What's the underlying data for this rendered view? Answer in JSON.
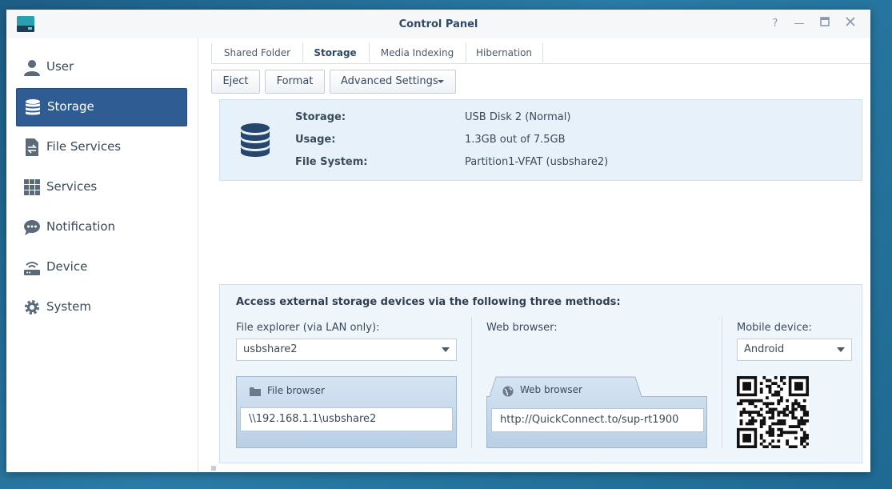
{
  "window": {
    "title": "Control Panel"
  },
  "sidebar": {
    "items": [
      {
        "label": "User",
        "icon": "user-icon"
      },
      {
        "label": "Storage",
        "icon": "storage-icon",
        "active": true
      },
      {
        "label": "File Services",
        "icon": "file-services-icon"
      },
      {
        "label": "Services",
        "icon": "services-grid-icon"
      },
      {
        "label": "Notification",
        "icon": "notification-icon"
      },
      {
        "label": "Device",
        "icon": "device-icon"
      },
      {
        "label": "System",
        "icon": "gear-icon"
      }
    ]
  },
  "tabs": [
    "Shared Folder",
    "Storage",
    "Media Indexing",
    "Hibernation"
  ],
  "toolbar": {
    "eject": "Eject",
    "format": "Format",
    "advanced": "Advanced Settings"
  },
  "info": {
    "storage_label": "Storage:",
    "storage_value": "USB Disk 2 (Normal)",
    "usage_label": "Usage:",
    "usage_value": "1.3GB out of 7.5GB",
    "fs_label": "File System:",
    "fs_value": "Partition1-VFAT (usbshare2)"
  },
  "access": {
    "title": "Access external storage devices via the following three methods:",
    "file_explorer_label": "File explorer (via LAN only):",
    "file_explorer_selected": "usbshare2",
    "file_browser_title": "File browser",
    "file_browser_path": "\\\\192.168.1.1\\usbshare2",
    "web_browser_label": "Web browser:",
    "web_browser_title": "Web browser",
    "web_browser_url": "http://QuickConnect.to/sup-rt1900",
    "mobile_label": "Mobile device:",
    "mobile_selected": "Android"
  },
  "colors": {
    "accent": "#2f5d93",
    "panel": "#e6f1fa",
    "desktop": "#1f6a93"
  }
}
